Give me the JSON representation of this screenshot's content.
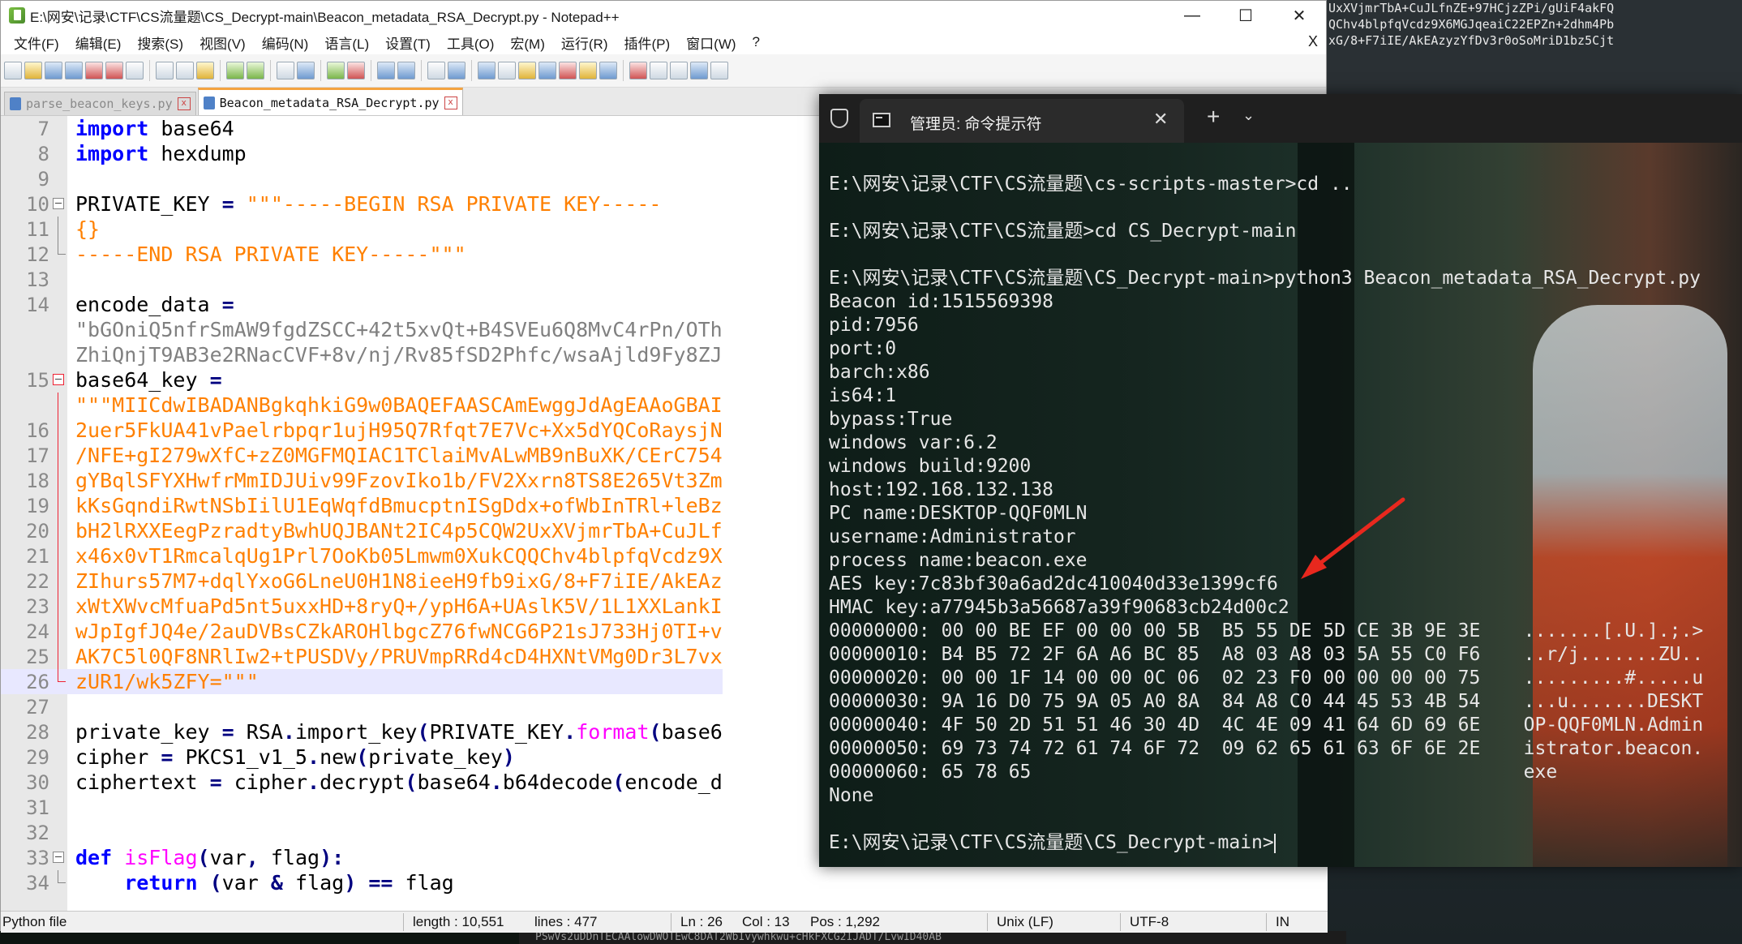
{
  "background": {
    "top_strip": [
      "UxXVjmrTbA+CuJLfnZE+97HCjzZPi/gUiF4akFQ",
      "QChv4blpfqVcdz9X6MGJqeaiC22EPZn+2dhm4Pb",
      "xG/8+F7iIE/AkEAzyzYfDv3r0oSoMriD1bz5Cjt"
    ],
    "bottom_strip": "PSwVs2uDDnTECAAlowDWOTEwC8DAT2WbIvywhkwu+cHkFXCG2IJADT/LvwID40AB"
  },
  "notepad": {
    "title": "E:\\网安\\记录\\CTF\\CS流量题\\CS_Decrypt-main\\Beacon_metadata_RSA_Decrypt.py - Notepad++",
    "window_buttons": {
      "minimize": "—",
      "maximize": "☐",
      "close": "✕"
    },
    "menu": [
      "文件(F)",
      "编辑(E)",
      "搜索(S)",
      "视图(V)",
      "编码(N)",
      "语言(L)",
      "设置(T)",
      "工具(O)",
      "宏(M)",
      "运行(R)",
      "插件(P)",
      "窗口(W)",
      "?"
    ],
    "menu_close": "X",
    "tabs": [
      {
        "label": "parse_beacon_keys.py",
        "active": false
      },
      {
        "label": "Beacon_metadata_RSA_Decrypt.py",
        "active": true
      }
    ],
    "tab_close": "x",
    "lines": [
      {
        "n": "7",
        "parts": [
          {
            "t": "import",
            "c": "kw"
          },
          {
            "t": " base64",
            "c": "plain"
          }
        ]
      },
      {
        "n": "8",
        "parts": [
          {
            "t": "import",
            "c": "kw"
          },
          {
            "t": " hexdump",
            "c": "plain"
          }
        ]
      },
      {
        "n": "9",
        "parts": []
      },
      {
        "n": "10",
        "fold": "box",
        "parts": [
          {
            "t": "PRIVATE_KEY ",
            "c": "plain"
          },
          {
            "t": "=",
            "c": "op"
          },
          {
            "t": " \"\"\"-----BEGIN RSA PRIVATE KEY-----",
            "c": "str"
          }
        ]
      },
      {
        "n": "11",
        "fold": "line",
        "parts": [
          {
            "t": "{}",
            "c": "str"
          }
        ]
      },
      {
        "n": "12",
        "fold": "end",
        "parts": [
          {
            "t": "-----END RSA PRIVATE KEY-----\"\"\"",
            "c": "str"
          }
        ]
      },
      {
        "n": "13",
        "parts": []
      },
      {
        "n": "14",
        "parts": [
          {
            "t": "encode_data ",
            "c": "plain"
          },
          {
            "t": "=",
            "c": "op"
          }
        ]
      },
      {
        "n": "",
        "parts": [
          {
            "t": "\"bGOniQ5nfrSmAW9fgdZSCC+42t5xvQt+B4SVEu6Q8MvC4rPn/OTh",
            "c": "strs"
          }
        ]
      },
      {
        "n": "",
        "parts": [
          {
            "t": "ZhiQnjT9AB3e2RNacCVF+8v/nj/Rv85fSD2Phfc/wsaAjld9Fy8ZJ",
            "c": "strs"
          }
        ]
      },
      {
        "n": "15",
        "fold": "redbox",
        "parts": [
          {
            "t": "base64_key ",
            "c": "plain"
          },
          {
            "t": "=",
            "c": "op"
          }
        ]
      },
      {
        "n": "",
        "fold": "redline",
        "parts": [
          {
            "t": "\"\"\"MIICdwIBADANBgkqhkiG9w0BAQEFAASCAmEwggJdAgEAAoGBAI",
            "c": "str"
          }
        ]
      },
      {
        "n": "16",
        "fold": "redline",
        "parts": [
          {
            "t": "2uer5FkUA41vPaelrbpqr1ujH95Q7Rfqt7E7Vc+Xx5dYQCoRaysjN",
            "c": "str"
          }
        ]
      },
      {
        "n": "17",
        "fold": "redline",
        "parts": [
          {
            "t": "/NFE+gI279wXfC+zZ0MGFMQIAC1TClaiMvALwMB9nBuXK/CErC754",
            "c": "str"
          }
        ]
      },
      {
        "n": "18",
        "fold": "redline",
        "parts": [
          {
            "t": "gYBqlSFYXHwfrMmIDJUiv99FzovIko1b/FV2Xxrn8TS8E265Vt3Zm",
            "c": "str"
          }
        ]
      },
      {
        "n": "19",
        "fold": "redline",
        "parts": [
          {
            "t": "kKsGqndiRwtNSbIilU1EqWqfdBmucptnISgDdx+ofWbInTRl+leBz",
            "c": "str"
          }
        ]
      },
      {
        "n": "20",
        "fold": "redline",
        "parts": [
          {
            "t": "bH2lRXXEegPzradtyBwhUQJBANt2IC4p5CQW2UxXVjmrTbA+CuJLf",
            "c": "str"
          }
        ]
      },
      {
        "n": "21",
        "fold": "redline",
        "parts": [
          {
            "t": "x46x0vT1RmcalqUg1Prl7OoKb05Lmwm0XukCQQChv4blpfqVcdz9X",
            "c": "str"
          }
        ]
      },
      {
        "n": "22",
        "fold": "redline",
        "parts": [
          {
            "t": "ZIhurs57M7+dqlYxoG6LneU0H1N8ieeH9fb9ixG/8+F7iIE/AkEAz",
            "c": "str"
          }
        ]
      },
      {
        "n": "23",
        "fold": "redline",
        "parts": [
          {
            "t": "xWtXWvcMfuaPd5nt5uxxHD+8ryQ+/ypH6A+UAslK5V/1L1XXLankI",
            "c": "str"
          }
        ]
      },
      {
        "n": "24",
        "fold": "redline",
        "parts": [
          {
            "t": "wJpIgfJQ4e/2auDVBsCZkAROHlbgcZ76fwNCG6P21sJ733Hj0TI+v",
            "c": "str"
          }
        ]
      },
      {
        "n": "25",
        "fold": "redline",
        "parts": [
          {
            "t": "AK7C5l0QF8NRlIw2+tPUSDVy/PRUVmpRRd4cD4HXNtVMg0Dr3L7vx",
            "c": "str"
          }
        ]
      },
      {
        "n": "26",
        "fold": "redend",
        "hl": true,
        "parts": [
          {
            "t": "zUR1/wk5ZFY=\"\"\"",
            "c": "str"
          }
        ]
      },
      {
        "n": "27",
        "parts": []
      },
      {
        "n": "28",
        "parts": [
          {
            "t": "private_key ",
            "c": "plain"
          },
          {
            "t": "=",
            "c": "op"
          },
          {
            "t": " RSA",
            "c": "plain"
          },
          {
            "t": ".",
            "c": "op"
          },
          {
            "t": "import_key",
            "c": "plain"
          },
          {
            "t": "(",
            "c": "op"
          },
          {
            "t": "PRIVATE_KEY",
            "c": "plain"
          },
          {
            "t": ".",
            "c": "op"
          },
          {
            "t": "format",
            "c": "fn"
          },
          {
            "t": "(",
            "c": "op"
          },
          {
            "t": "base6",
            "c": "plain"
          }
        ]
      },
      {
        "n": "29",
        "parts": [
          {
            "t": "cipher ",
            "c": "plain"
          },
          {
            "t": "=",
            "c": "op"
          },
          {
            "t": " PKCS1_v1_5",
            "c": "plain"
          },
          {
            "t": ".",
            "c": "op"
          },
          {
            "t": "new",
            "c": "plain"
          },
          {
            "t": "(",
            "c": "op"
          },
          {
            "t": "private_key",
            "c": "plain"
          },
          {
            "t": ")",
            "c": "op"
          }
        ]
      },
      {
        "n": "30",
        "parts": [
          {
            "t": "ciphertext ",
            "c": "plain"
          },
          {
            "t": "=",
            "c": "op"
          },
          {
            "t": " cipher",
            "c": "plain"
          },
          {
            "t": ".",
            "c": "op"
          },
          {
            "t": "decrypt",
            "c": "plain"
          },
          {
            "t": "(",
            "c": "op"
          },
          {
            "t": "base64",
            "c": "plain"
          },
          {
            "t": ".",
            "c": "op"
          },
          {
            "t": "b64decode",
            "c": "plain"
          },
          {
            "t": "(",
            "c": "op"
          },
          {
            "t": "encode_d",
            "c": "plain"
          }
        ]
      },
      {
        "n": "31",
        "parts": []
      },
      {
        "n": "32",
        "parts": []
      },
      {
        "n": "33",
        "fold": "box",
        "parts": [
          {
            "t": "def",
            "c": "kw"
          },
          {
            "t": " isFlag",
            "c": "fn"
          },
          {
            "t": "(",
            "c": "op"
          },
          {
            "t": "var",
            "c": "plain"
          },
          {
            "t": ",",
            "c": "op"
          },
          {
            "t": " flag",
            "c": "plain"
          },
          {
            "t": "):",
            "c": "op"
          }
        ]
      },
      {
        "n": "34",
        "fold": "end",
        "parts": [
          {
            "t": "    ",
            "c": "plain"
          },
          {
            "t": "return",
            "c": "kw"
          },
          {
            "t": " ",
            "c": "plain"
          },
          {
            "t": "(",
            "c": "op"
          },
          {
            "t": "var ",
            "c": "plain"
          },
          {
            "t": "&",
            "c": "op"
          },
          {
            "t": " flag",
            "c": "plain"
          },
          {
            "t": ")",
            "c": "op"
          },
          {
            "t": " ",
            "c": "plain"
          },
          {
            "t": "==",
            "c": "op"
          },
          {
            "t": " flag",
            "c": "plain"
          }
        ]
      }
    ],
    "status": {
      "filetype": "Python file",
      "length": "length : 10,551",
      "lines": "lines : 477",
      "ln": "Ln : 26",
      "col": "Col : 13",
      "pos": "Pos : 1,292",
      "eol": "Unix (LF)",
      "encoding": "UTF-8",
      "mode": "IN"
    }
  },
  "terminal": {
    "tab_title": "管理员: 命令提示符",
    "tab_close": "✕",
    "new_tab": "+",
    "dropdown": "⌄",
    "lines": [
      "",
      "E:\\网安\\记录\\CTF\\CS流量题\\cs-scripts-master>cd ..",
      "",
      "E:\\网安\\记录\\CTF\\CS流量题>cd CS_Decrypt-main",
      "",
      "E:\\网安\\记录\\CTF\\CS流量题\\CS_Decrypt-main>python3 Beacon_metadata_RSA_Decrypt.py",
      "Beacon id:1515569398",
      "pid:7956",
      "port:0",
      "barch:x86",
      "is64:1",
      "bypass:True",
      "windows var:6.2",
      "windows build:9200",
      "host:192.168.132.138",
      "PC name:DESKTOP-QQF0MLN",
      "username:Administrator",
      "process name:beacon.exe",
      "AES key:7c83bf30a6ad2dc410040d33e1399cf6",
      "HMAC key:a77945b3a56687a39f90683cb24d00c2"
    ],
    "hexdump": [
      {
        "off": "00000000:",
        "bytes": "00 00 BE EF 00 00 00 5B  B5 55 DE 5D CE 3B 9E 3E",
        "ascii": ".......[.U.].;.>"
      },
      {
        "off": "00000010:",
        "bytes": "B4 B5 72 2F 6A A6 BC 85  A8 03 A8 03 5A 55 C0 F6",
        "ascii": "..r/j.......ZU.."
      },
      {
        "off": "00000020:",
        "bytes": "00 00 1F 14 00 00 0C 06  02 23 F0 00 00 00 00 75",
        "ascii": ".........#.....u"
      },
      {
        "off": "00000030:",
        "bytes": "9A 16 D0 75 9A 05 A0 8A  84 A8 C0 44 45 53 4B 54",
        "ascii": "...u.......DESKT"
      },
      {
        "off": "00000040:",
        "bytes": "4F 50 2D 51 51 46 30 4D  4C 4E 09 41 64 6D 69 6E",
        "ascii": "OP-QQF0MLN.Admin"
      },
      {
        "off": "00000050:",
        "bytes": "69 73 74 72 61 74 6F 72  09 62 65 61 63 6F 6E 2E",
        "ascii": "istrator.beacon."
      },
      {
        "off": "00000060:",
        "bytes": "65 78 65",
        "ascii": "exe"
      }
    ],
    "after": [
      "None",
      ""
    ],
    "prompt": "E:\\网安\\记录\\CTF\\CS流量题\\CS_Decrypt-main>"
  },
  "colors": {
    "keyword": "#0000ff",
    "string": "#ff8000",
    "triple_string_gray": "#808080",
    "function": "#ff00ff",
    "arrow": "#e8281e",
    "terminal_text": "#e6e6e6"
  }
}
